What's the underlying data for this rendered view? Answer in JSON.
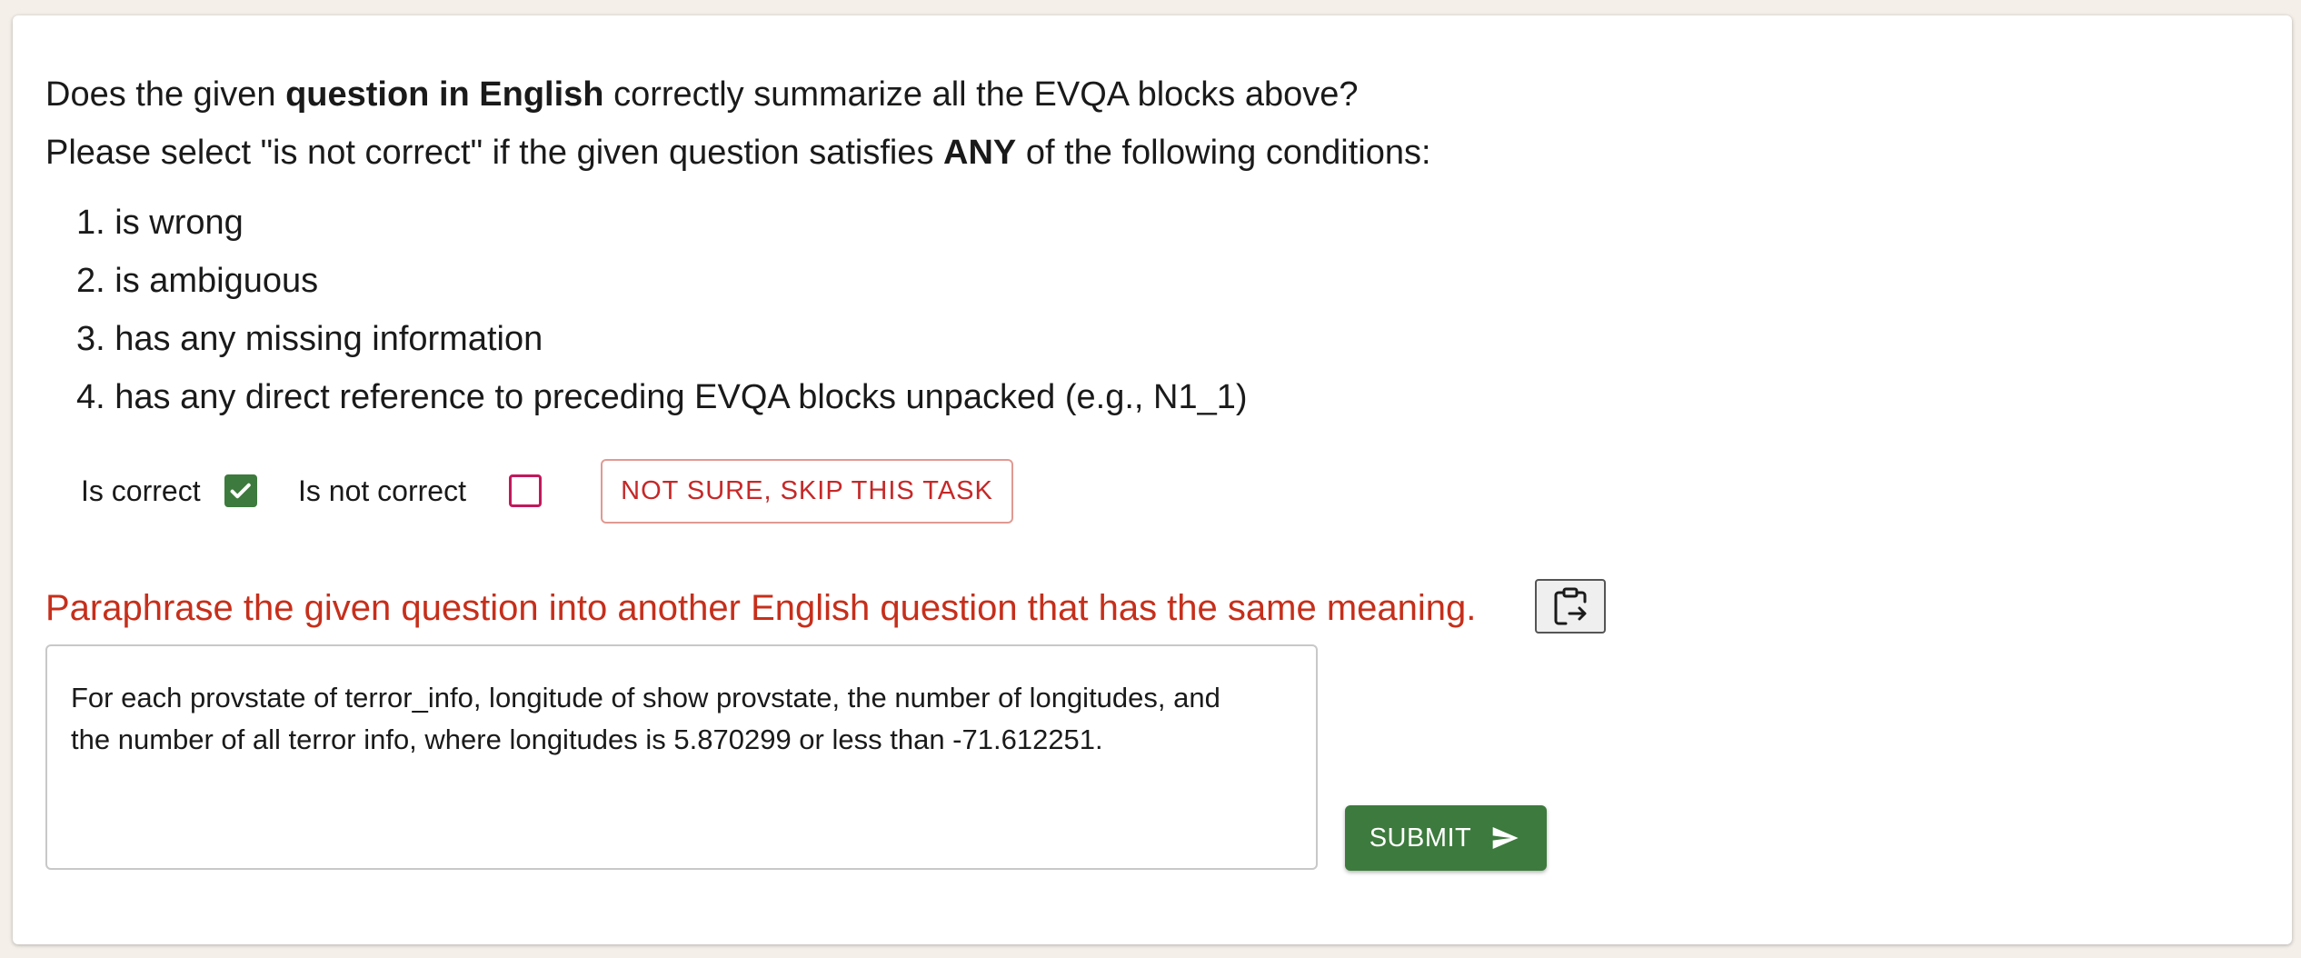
{
  "instructions": {
    "line1_pre": "Does the given ",
    "line1_bold": "question in English",
    "line1_post": " correctly summarize all the EVQA blocks above?",
    "line2_pre": "Please select \"is not correct\" if the given question satisfies ",
    "line2_bold": "ANY",
    "line2_post": " of the following conditions:",
    "conditions": [
      "1. is wrong",
      "2. is ambiguous",
      "3. has any missing information",
      "4. has any direct reference to preceding EVQA blocks unpacked (e.g., N1_1)"
    ]
  },
  "choices": {
    "correct_label": "Is correct",
    "correct_checked": true,
    "not_correct_label": "Is not correct",
    "not_correct_checked": false,
    "skip_label": "NOT SURE, SKIP THIS TASK"
  },
  "paraphrase": {
    "title": "Paraphrase the given question into another English question that has the same meaning.",
    "text": "For each provstate of terror_info, longitude of show provstate, the number of longitudes, and\nthe number of all terror info, where longitudes is 5.870299 or less than -71.612251.",
    "clipboard_icon": "clipboard-paste-icon"
  },
  "submit": {
    "label": "SUBMIT",
    "icon": "send-icon"
  },
  "colors": {
    "accent_green": "#3d7a3d",
    "accent_red": "#c62f1b",
    "checkbox_unchecked_border": "#c2185b"
  }
}
